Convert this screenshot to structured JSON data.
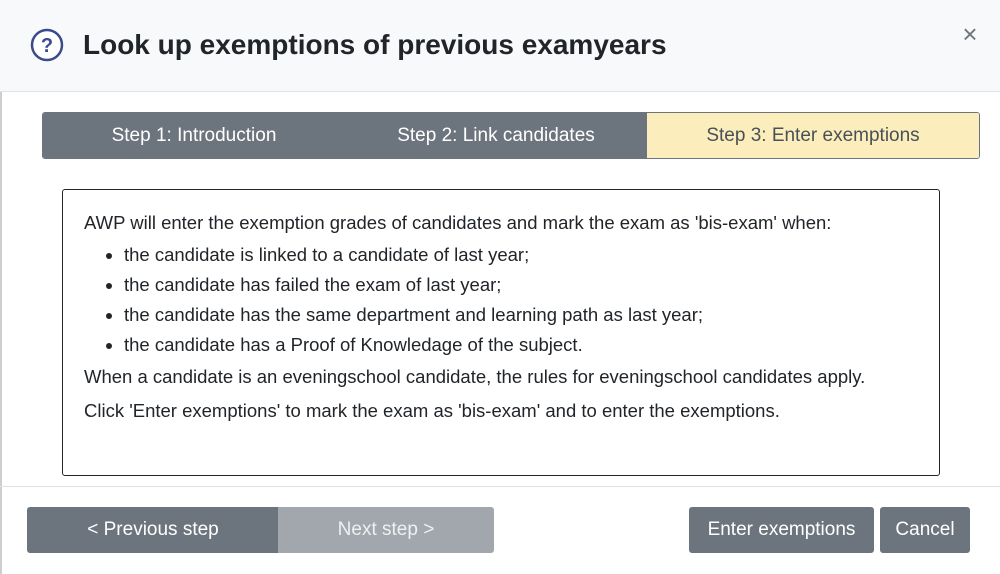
{
  "dialog": {
    "title": "Look up exemptions of previous examyears",
    "close_symbol": "×"
  },
  "steps": [
    {
      "label": "Step 1: Introduction"
    },
    {
      "label": "Step 2: Link candidates"
    },
    {
      "label": "Step 3: Enter exemptions"
    }
  ],
  "info": {
    "intro": "AWP will enter the exemption grades of candidates and mark the exam as 'bis-exam' when:",
    "conditions": [
      "the candidate is linked to a candidate of last year;",
      "the candidate has failed the exam of last year;",
      "the candidate has the same department and learning path as last year;",
      "the candidate has a Proof of Knowledage of the subject."
    ],
    "evening_rule": "When a candidate is an eveningschool candidate, the rules for eveningschool candidates apply.",
    "instruction": "Click 'Enter exemptions' to mark the exam as 'bis-exam' and to enter the exemptions."
  },
  "footer": {
    "prev_label": "< Previous step",
    "next_label": "Next step >",
    "enter_label": "Enter exemptions",
    "cancel_label": "Cancel"
  },
  "icons": {
    "help": "question-circle-icon",
    "close": "close-icon"
  },
  "colors": {
    "button": "#6c757d",
    "button_disabled": "#a1a7ad",
    "active_step": "#fbeebc",
    "help_icon": "#3b4a8c"
  }
}
